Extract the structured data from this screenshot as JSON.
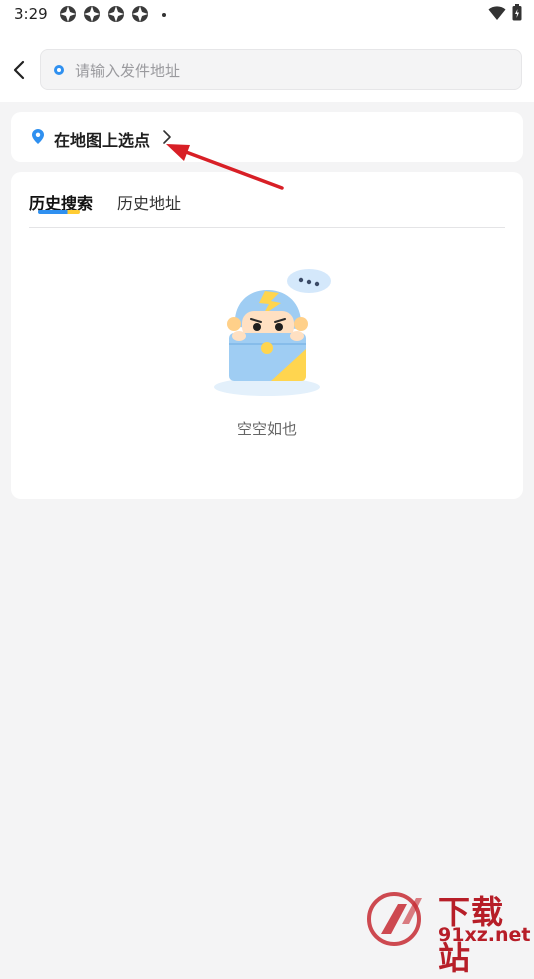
{
  "status_bar": {
    "time": "3:29"
  },
  "search": {
    "placeholder": "请输入发件地址",
    "value": ""
  },
  "map_select": {
    "label": "在地图上选点"
  },
  "tabs": [
    {
      "label": "历史搜索",
      "active": true
    },
    {
      "label": "历史地址",
      "active": false
    }
  ],
  "empty_state": {
    "text": "空空如也"
  },
  "watermark": {
    "brand_cn": "下载站",
    "brand_en": "91xz.net"
  },
  "colors": {
    "accent_blue": "#2f90f0",
    "accent_yellow": "#ffcc33",
    "annotation_red": "#d81f26"
  }
}
